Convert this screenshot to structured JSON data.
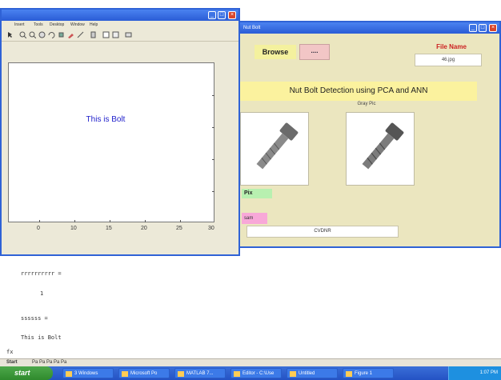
{
  "command_window": {
    "line1": "rrrrrrrrrr =",
    "line2": "1",
    "line3": "ssssss =",
    "line4": "This is Bolt"
  },
  "status_bar": {
    "start_label": "Start",
    "text": "Pa Pa Pa Pa Pa"
  },
  "taskbar": {
    "start_label": "start",
    "items": [
      "3 Windows",
      "Microsoft Po",
      "MATLAB 7...",
      "Editor - C:\\Use",
      "Untitled",
      "Figure 1"
    ],
    "clock": "1:07 PM"
  },
  "gui": {
    "title": "Nut Bolt",
    "browse_label": "Browse",
    "browse_button": "....",
    "file_name_title": "File Name",
    "file_name_value": "46.jpg",
    "banner": "Nut Bolt Detection using PCA and ANN",
    "gray_label": "Gray Pic",
    "pix_label": "Pix",
    "pink_label": "sam",
    "result_text": "CVDNR",
    "colors": {
      "bg": "#ebe6bf",
      "banner": "#fbf29e",
      "pix": "#b8f0b0",
      "pink": "#f8a8d8"
    }
  },
  "figure": {
    "menu": [
      "Insert",
      "Tools",
      "Desktop",
      "Window",
      "Help"
    ],
    "axes_text": "This is Bolt",
    "xticks": [
      "0",
      "10",
      "15",
      "20",
      "25",
      "30"
    ],
    "toolbar_icons": [
      "arrow-icon",
      "zoom-in-icon",
      "zoom-out-icon",
      "pan-icon",
      "rotate-icon",
      "datacursor-icon",
      "brush-icon",
      "link-icon",
      "colorbar-icon",
      "legend-icon",
      "grid-icon",
      "plot-tools-icon"
    ]
  }
}
